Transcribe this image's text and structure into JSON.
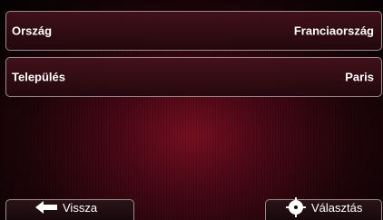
{
  "fields": [
    {
      "label": "Ország",
      "value": "Franciaország"
    },
    {
      "label": "Település",
      "value": "Paris"
    }
  ],
  "buttons": {
    "back_label": "Vissza",
    "back_icon": "arrow-left-icon",
    "select_label": "Választás",
    "select_icon": "crosshair-icon"
  },
  "colors": {
    "background_center": "#7a0f22",
    "border": "#9a8a8e",
    "text": "#ffffff"
  }
}
